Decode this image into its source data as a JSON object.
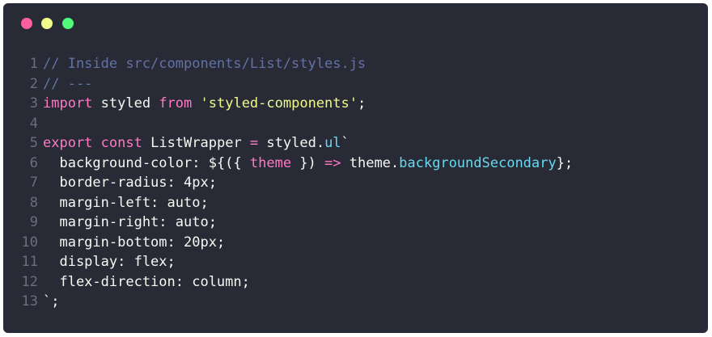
{
  "window": {
    "controls": {
      "close_color": "#ff5f9e",
      "minimize_color": "#f1fa8c",
      "maximize_color": "#50fa7b"
    }
  },
  "code": {
    "lines": [
      {
        "num": "1",
        "tokens": [
          {
            "t": "comment",
            "v": "// Inside src/components/List/styles.js"
          }
        ]
      },
      {
        "num": "2",
        "tokens": [
          {
            "t": "comment",
            "v": "// ---"
          }
        ]
      },
      {
        "num": "3",
        "tokens": [
          {
            "t": "keyword",
            "v": "import"
          },
          {
            "t": "plain",
            "v": " styled "
          },
          {
            "t": "keyword",
            "v": "from"
          },
          {
            "t": "plain",
            "v": " "
          },
          {
            "t": "string",
            "v": "'styled-components'"
          },
          {
            "t": "plain",
            "v": ";"
          }
        ]
      },
      {
        "num": "4",
        "tokens": []
      },
      {
        "num": "5",
        "tokens": [
          {
            "t": "keyword",
            "v": "export"
          },
          {
            "t": "plain",
            "v": " "
          },
          {
            "t": "keyword",
            "v": "const"
          },
          {
            "t": "plain",
            "v": " ListWrapper "
          },
          {
            "t": "keyword",
            "v": "="
          },
          {
            "t": "plain",
            "v": " styled."
          },
          {
            "t": "prop",
            "v": "ul"
          },
          {
            "t": "plain",
            "v": "`"
          }
        ]
      },
      {
        "num": "6",
        "tokens": [
          {
            "t": "plain",
            "v": "  background-color: ${({ "
          },
          {
            "t": "param",
            "v": "theme"
          },
          {
            "t": "plain",
            "v": " }) "
          },
          {
            "t": "keyword",
            "v": "=>"
          },
          {
            "t": "plain",
            "v": " theme."
          },
          {
            "t": "prop",
            "v": "backgroundSecondary"
          },
          {
            "t": "plain",
            "v": "};"
          }
        ]
      },
      {
        "num": "7",
        "tokens": [
          {
            "t": "plain",
            "v": "  border-radius: 4px;"
          }
        ]
      },
      {
        "num": "8",
        "tokens": [
          {
            "t": "plain",
            "v": "  margin-left: auto;"
          }
        ]
      },
      {
        "num": "9",
        "tokens": [
          {
            "t": "plain",
            "v": "  margin-right: auto;"
          }
        ]
      },
      {
        "num": "10",
        "tokens": [
          {
            "t": "plain",
            "v": "  margin-bottom: 20px;"
          }
        ]
      },
      {
        "num": "11",
        "tokens": [
          {
            "t": "plain",
            "v": "  display: flex;"
          }
        ]
      },
      {
        "num": "12",
        "tokens": [
          {
            "t": "plain",
            "v": "  flex-direction: column;"
          }
        ]
      },
      {
        "num": "13",
        "tokens": [
          {
            "t": "plain",
            "v": "`;"
          }
        ]
      }
    ]
  }
}
